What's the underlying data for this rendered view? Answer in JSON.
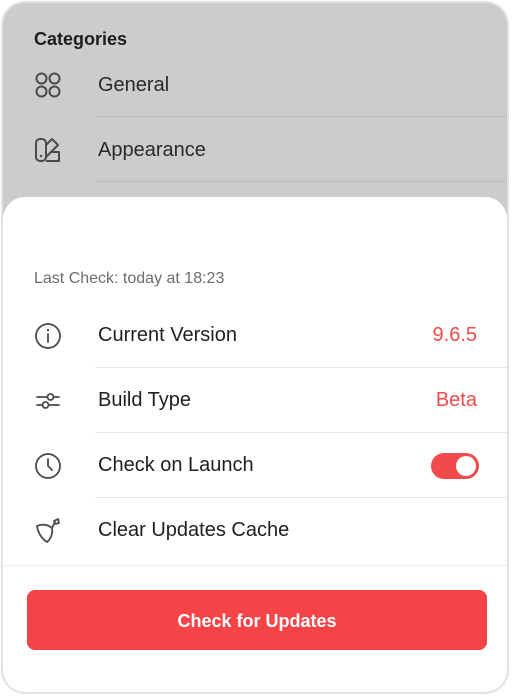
{
  "categories": {
    "title": "Categories",
    "items": [
      {
        "label": "General",
        "icon": "grid-icon"
      },
      {
        "label": "Appearance",
        "icon": "palette-icon"
      }
    ]
  },
  "updates": {
    "last_check": "Last Check: today at 18:23",
    "rows": [
      {
        "label": "Current Version",
        "value": "9.6.5",
        "icon": "info-icon"
      },
      {
        "label": "Build Type",
        "value": "Beta",
        "icon": "sliders-icon"
      },
      {
        "label": "Check on Launch",
        "icon": "clock-icon",
        "toggle_on": true
      },
      {
        "label": "Clear Updates Cache",
        "icon": "brush-icon"
      }
    ],
    "button_label": "Check for Updates"
  },
  "colors": {
    "accent": "#f14a4b",
    "button": "#f54447",
    "overlay_background": "#cccccc",
    "sheet_background": "#ffffff"
  }
}
